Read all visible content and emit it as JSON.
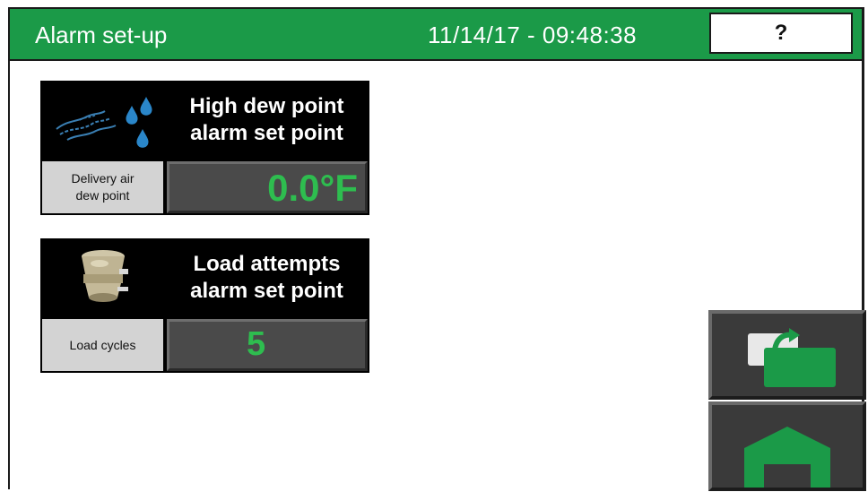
{
  "header": {
    "title": "Alarm set-up",
    "datetime": "11/14/17 - 09:48:38",
    "help_label": "?"
  },
  "cards": [
    {
      "icon": "dew-point-icon",
      "title": "High dew point\nalarm set point",
      "param_label": "Delivery air\ndew point",
      "value": "0.0°F"
    },
    {
      "icon": "loader-icon",
      "title": "Load attempts\nalarm set point",
      "param_label": "Load cycles",
      "value": "5"
    }
  ],
  "nav": {
    "back_icon": "return-screen-icon",
    "home_icon": "home-icon"
  },
  "colors": {
    "header_green": "#1b9a48",
    "value_green": "#2ebd4f",
    "button_gray": "#3a3a3a"
  }
}
